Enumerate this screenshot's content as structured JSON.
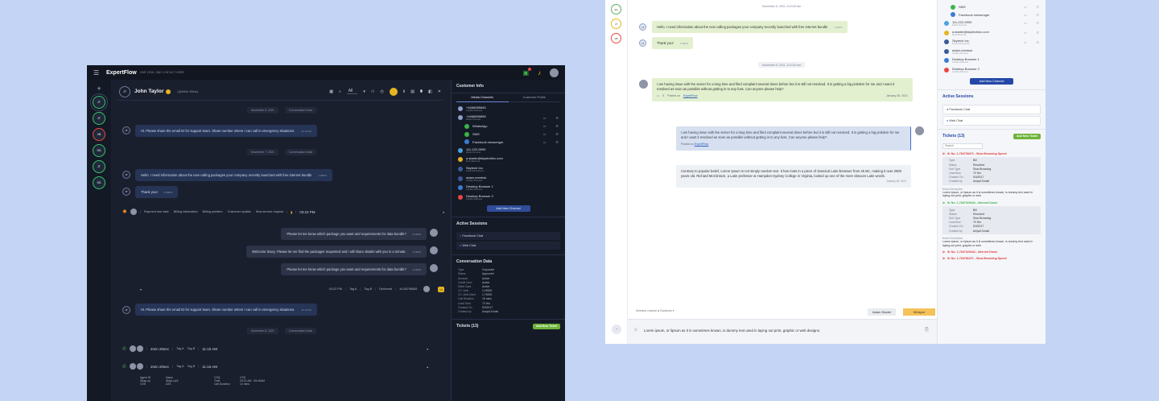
{
  "dark": {
    "logo": "ExpertFlow",
    "logo_sub": "ONE VIEW, ONE CONTACT HERE",
    "rail_channels": [
      "JT",
      "JT",
      "VB",
      "SG",
      "JT",
      "SG"
    ],
    "header": {
      "initials": "JT",
      "name": "John Taylor",
      "handle": "(@heile 55ew)",
      "filter": "All"
    },
    "messages": {
      "date1": "November 5, 2021",
      "date1_tag": "Conversation Data",
      "m1": "Hi. Please share the email ID for support team. Share number where I can call in emergency situations.",
      "m1_time": "11:13 AM",
      "date2": "November 7, 2021",
      "date2_tag": "Conversation Data",
      "m2": "Hello. I need information about the new calling packages your company recently launched with free internet bundle",
      "m2_time": "3:38PM",
      "m3": "Thank you!",
      "m3_time": "3:38PM",
      "wrap_tags": [
        "Payment due date",
        "Billing information",
        "Billing problem",
        "Customer update",
        "New service request"
      ],
      "wrap_time": "03:22 PM",
      "o1": "Please let me know which package you want and requirements for data bundle?",
      "o1_time": "3:40PM",
      "o2": "Welcome Stacy. Please let me find the packages requested and i will share details with you in a minute.",
      "o2_time": "3:40PM",
      "o3": "Please let me know which package you want and requirements for data bundle?",
      "o3_time": "3:40PM",
      "sum_time": "03:22 PM",
      "sum_tag1": "Tag A",
      "sum_tag2": "Tag B",
      "sum_status": "Delivered",
      "sum_num": "44.85798685",
      "m4": "Hi. Please share the email ID for support team. Share number where I can call in emergency situations.",
      "m4_time": "11:13 AM",
      "date3": "November 8, 2021",
      "date3_tag": "Conversation Data",
      "call1": {
        "dur": "2min 20sec",
        "tag1": "Tag A",
        "tag2": "Tag B",
        "time": "11:15 AM"
      },
      "call2": {
        "dur": "2min 20sec",
        "tag1": "Tag A",
        "tag2": "Tag B",
        "time": "11:15 AM"
      },
      "call_details": [
        [
          "Agent ID",
          "Name",
          "CSQ",
          "CSS"
        ],
        [
          "Wrap-up",
          "Wrap-Up3",
          "Time",
          "03:21 AM - 05:45AM"
        ],
        [
          "CSS",
          "ZZS",
          "Call Duration",
          "14 mins"
        ]
      ]
    },
    "side": {
      "title": "Customer Info",
      "tab1": "Media Channels",
      "tab2": "Customer Profile",
      "channels": [
        {
          "name": "+4466985845",
          "sub": "Landline Business",
          "color": "#8aa0c8"
        },
        {
          "name": "+4466895898",
          "sub": "Mobile Personal",
          "color": "#8aa0c8"
        },
        {
          "name": "WhatsApp",
          "sub": "",
          "color": "#3bb54a"
        },
        {
          "name": "SMS",
          "sub": "",
          "color": "#3bb54a"
        },
        {
          "name": "Facebook messenger",
          "sub": "",
          "color": "#3a7bd5"
        },
        {
          "name": "111-222-9999",
          "sub": "Mobile Personal",
          "color": "#4aa3df"
        },
        {
          "name": "a.starler@skytechinc.com",
          "sub": "Email Business",
          "color": "#e4b420"
        },
        {
          "name": "Skytech Inc.",
          "sub": "Facebook Business",
          "color": "#3a5a98"
        },
        {
          "name": "adam.meebuk",
          "sub": "Landline Business",
          "color": "#3a5a98"
        },
        {
          "name": "Desktop Browser 1",
          "sub": "Landline Business",
          "color": "#3a7bd5"
        },
        {
          "name": "Desktop Browser 2",
          "sub": "Landline Business",
          "color": "#e94545"
        }
      ],
      "add_channel": "Add New Channel",
      "sessions_title": "Active Sessions",
      "sessions": [
        "Facebook Chat",
        "Web Chat"
      ],
      "conv_title": "Conversation Data",
      "conv": [
        [
          "Type",
          "Corporate"
        ],
        [
          "Status",
          "Approved"
        ],
        [
          "Account",
          "Active"
        ],
        [
          "Credit Card",
          "Active"
        ],
        [
          "Debit Card",
          "Active"
        ],
        [
          "CC Limit",
          "2,25000"
        ],
        [
          "CC Limit Used",
          "1,75000"
        ],
        [
          "Call Duration",
          "15 mins"
        ],
        [
          "Lead Time",
          "70 Hrs"
        ],
        [
          "Created On",
          "5/3/2017"
        ],
        [
          "Created by",
          "Amjad Sohail"
        ]
      ],
      "tickets_title": "Tickets (13)",
      "add_ticket": "Add New Ticket"
    }
  },
  "light": {
    "rail_channels": [
      "SG",
      "JT",
      "VB"
    ],
    "date1": "November 5, 2021, 6:10:30 am",
    "m1": "Hello. I need information about the new calling packages your company recently launched with free internet bundle",
    "m1_time": "3:38PM",
    "m2": "Thank you!",
    "m2_time": "3:38PM",
    "date2": "November 5, 2021, 6:10:30 am",
    "w1": "I am having issue with the server for a long time and filed complaint several times before but it is still not resolved. It is getting a big problem for me and I want it resolved as soon as possible without getting in to any fuss. Can anyone please help?",
    "w1_posted": "Posted on",
    "w1_link": "ExpertFlow",
    "w1_count": "6",
    "w1_date": "January 26, 2021",
    "o1": "I am having issue with the server for a long time and filed complaint several times before but it is still not resolved. It is getting a big problem for me and I want it resolved as soon as possible without getting in to any fuss. Can anyone please help?",
    "o1_posted": "Posted on",
    "o1_link": "ExpertFlow",
    "o2": "Contrary to popular belief, Lorem Ipsum is not simply random text. It has roots in a piece of classical Latin literature from 45 BC, making it over 2000 years old. Richard McClintock, a Latin professor at Hampden-Sydney College in Virginia, looked up one of the more obscure Latin words.",
    "o2_date": "January 26, 2021",
    "comp_label": "Selected channel",
    "comp_channel": "Facebook",
    "tab_agent": "Adam Starler",
    "tab_whisper": "Whisper",
    "composer": "Lorem ipsum, or lipsum as it is sometimes known, is dummy text used in laying out print, graphic or web designs.",
    "side": {
      "channels": [
        {
          "name": "SMS",
          "sub": "",
          "color": "#3bb54a"
        },
        {
          "name": "Facebook messenger",
          "sub": "",
          "color": "#3a7bd5"
        },
        {
          "name": "111-222-9999",
          "sub": "Mobile Personal",
          "color": "#4aa3df"
        },
        {
          "name": "a.starler@skytechinc.com",
          "sub": "Email Business",
          "color": "#e4b420"
        },
        {
          "name": "Skytech Inc.",
          "sub": "Facebook Business",
          "color": "#3a5a98"
        },
        {
          "name": "adam.meebuk",
          "sub": "Landline Business",
          "color": "#3a5a98"
        },
        {
          "name": "Desktop Browser 1",
          "sub": "Landline Business",
          "color": "#3a7bd5"
        },
        {
          "name": "Desktop Browser 2",
          "sub": "Landline Business",
          "color": "#e94545"
        }
      ],
      "add_channel": "Add New Channel",
      "sessions_title": "Active Sessions",
      "sessions": [
        "Facebook Chat",
        "Web Chat"
      ],
      "tickets_title": "Tickets (13)",
      "add_ticket": "Add New Ticket",
      "search_placeholder": "Search",
      "tickets": [
        {
          "title": "Sr No. 1-784738472 - Slow Browsing Speed",
          "color": "#e03b3b",
          "fields": [
            [
              "Type",
              "Bill"
            ],
            [
              "Status",
              "Resolved"
            ],
            [
              "Sub Type",
              "Slow Browsing"
            ],
            [
              "Lead time",
              "70 Hrs"
            ],
            [
              "Created On",
              "5/3/2017"
            ],
            [
              "Created by",
              "Amjad Sohail"
            ]
          ],
          "notes_h": "Notes Description",
          "notes": "Lorem ipsum, or lipsum as it is sometimes known, is dummy text used in laying out print, graphic or web"
        },
        {
          "title": "Sr No. 1-7847325444 - Internet Down",
          "color": "#3bb54a",
          "fields": [
            [
              "Type",
              "Bill"
            ],
            [
              "Status",
              "Resolved"
            ],
            [
              "Sub Type",
              "Slow Browsing"
            ],
            [
              "Lead time",
              "70 Hrs"
            ],
            [
              "Created On",
              "5/3/2017"
            ],
            [
              "Created by",
              "Amjad Sohail"
            ]
          ],
          "notes_h": "Notes Description",
          "notes": "Lorem ipsum, or lipsum as it is sometimes known, is dummy text used in laying out print, graphic or web"
        },
        {
          "title": "Sr No. 1-7847325444 - Internet Down",
          "color": "#e03b3b",
          "fields": [],
          "notes_h": "",
          "notes": ""
        },
        {
          "title": "Sr No. 1-784786471 - Slow Browsing Speed",
          "color": "#e03b3b",
          "fields": [],
          "notes_h": "",
          "notes": ""
        }
      ]
    }
  }
}
